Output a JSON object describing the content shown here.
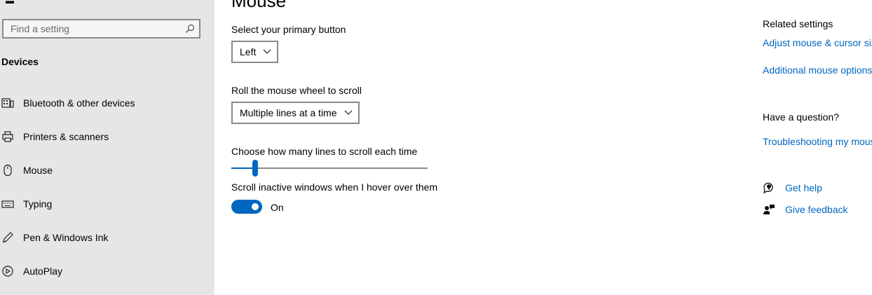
{
  "sidebar": {
    "search_placeholder": "Find a setting",
    "section_title": "Devices",
    "items": [
      {
        "label": "Bluetooth & other devices",
        "icon": "bluetooth-devices-icon"
      },
      {
        "label": "Printers & scanners",
        "icon": "printer-icon"
      },
      {
        "label": "Mouse",
        "icon": "mouse-icon"
      },
      {
        "label": "Typing",
        "icon": "keyboard-icon"
      },
      {
        "label": "Pen & Windows Ink",
        "icon": "pen-icon"
      },
      {
        "label": "AutoPlay",
        "icon": "autoplay-icon"
      }
    ]
  },
  "main": {
    "title": "Mouse",
    "primary_button": {
      "label": "Select your primary button",
      "value": "Left"
    },
    "wheel_scroll": {
      "label": "Roll the mouse wheel to scroll",
      "value": "Multiple lines at a time"
    },
    "lines_slider": {
      "label": "Choose how many lines to scroll each time",
      "value_fraction": 0.12
    },
    "inactive_scroll": {
      "label": "Scroll inactive windows when I hover over them",
      "state": "On"
    }
  },
  "related": {
    "heading": "Related settings",
    "links": [
      "Adjust mouse & cursor size",
      "Additional mouse options"
    ],
    "question_heading": "Have a question?",
    "question_link": "Troubleshooting my mouse",
    "get_help": "Get help",
    "give_feedback": "Give feedback"
  },
  "colors": {
    "accent": "#0067c0",
    "sidebar_bg": "#e6e6e6"
  }
}
